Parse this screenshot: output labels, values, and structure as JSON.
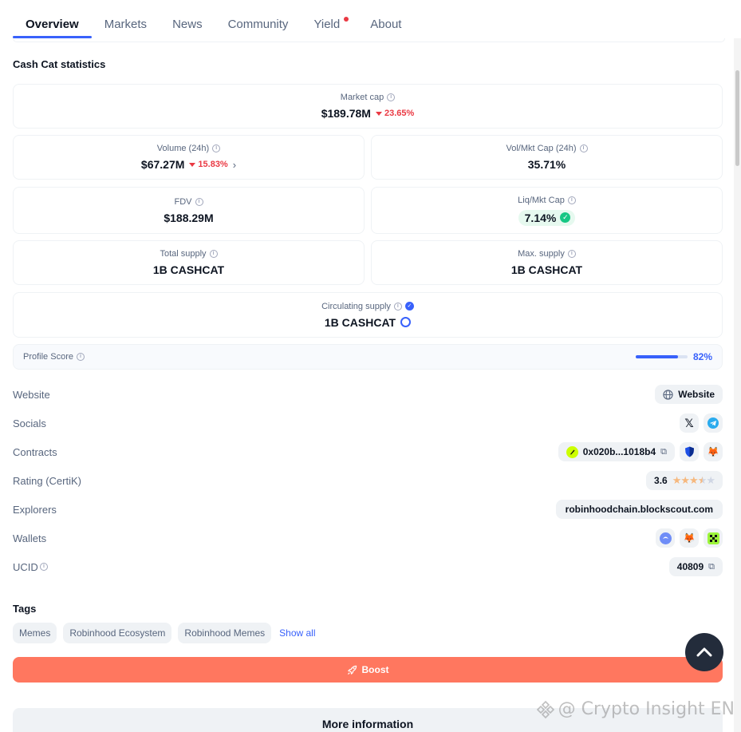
{
  "tabs": [
    {
      "label": "Overview",
      "active": true
    },
    {
      "label": "Markets"
    },
    {
      "label": "News"
    },
    {
      "label": "Community"
    },
    {
      "label": "Yield",
      "dot": true
    },
    {
      "label": "About"
    }
  ],
  "stats": {
    "title": "Cash Cat statistics",
    "market_cap": {
      "label": "Market cap",
      "value": "$189.78M",
      "change": "23.65%"
    },
    "volume": {
      "label": "Volume (24h)",
      "value": "$67.27M",
      "change": "15.83%"
    },
    "vol_mkt": {
      "label": "Vol/Mkt Cap (24h)",
      "value": "35.71%"
    },
    "fdv": {
      "label": "FDV",
      "value": "$188.29M"
    },
    "liq_mkt": {
      "label": "Liq/Mkt Cap",
      "value": "7.14%"
    },
    "total_supply": {
      "label": "Total supply",
      "value": "1B CASHCAT"
    },
    "max_supply": {
      "label": "Max. supply",
      "value": "1B CASHCAT"
    },
    "circ_supply": {
      "label": "Circulating supply",
      "value": "1B CASHCAT"
    }
  },
  "profile": {
    "label": "Profile Score",
    "value": "82%",
    "fraction": 0.82
  },
  "info": {
    "website": {
      "label": "Website",
      "value": "Website"
    },
    "socials": {
      "label": "Socials"
    },
    "contracts": {
      "label": "Contracts",
      "value": "0x020b...1018b4"
    },
    "rating": {
      "label": "Rating (CertiK)",
      "value": "3.6",
      "stars": 3.6
    },
    "explorers": {
      "label": "Explorers",
      "value": "robinhoodchain.blockscout.com"
    },
    "wallets": {
      "label": "Wallets"
    },
    "ucid": {
      "label": "UCID",
      "value": "40809"
    }
  },
  "tags": {
    "title": "Tags",
    "items": [
      "Memes",
      "Robinhood Ecosystem",
      "Robinhood Memes"
    ],
    "show_all": "Show all"
  },
  "boost_label": "Boost",
  "more_info_label": "More information",
  "watermark": "@ Crypto Insight EN",
  "colors": {
    "accent": "#3861fb",
    "down": "#ea3943",
    "up": "#16c784",
    "boost": "#ff775f"
  }
}
